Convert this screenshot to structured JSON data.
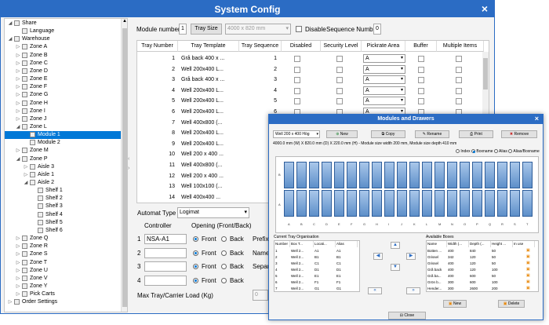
{
  "window": {
    "title": "System Config",
    "close": "×"
  },
  "tree": {
    "items": [
      {
        "label": "Share",
        "level": 0,
        "arrow": "◢",
        "icon": "share-icon"
      },
      {
        "label": "Language",
        "level": 1,
        "arrow": "",
        "icon": "globe-icon"
      },
      {
        "label": "Warehouse",
        "level": 0,
        "arrow": "◢",
        "icon": "warehouse-icon"
      },
      {
        "label": "Zone A",
        "level": 1,
        "arrow": "▷",
        "icon": "zone-icon"
      },
      {
        "label": "Zone B",
        "level": 1,
        "arrow": "▷",
        "icon": "zone-icon"
      },
      {
        "label": "Zone C",
        "level": 1,
        "arrow": "▷",
        "icon": "zone-icon"
      },
      {
        "label": "Zone D",
        "level": 1,
        "arrow": "▷",
        "icon": "zone-icon"
      },
      {
        "label": "Zone E",
        "level": 1,
        "arrow": "▷",
        "icon": "zone-icon"
      },
      {
        "label": "Zone F",
        "level": 1,
        "arrow": "▷",
        "icon": "zone-icon"
      },
      {
        "label": "Zone G",
        "level": 1,
        "arrow": "▷",
        "icon": "zone-icon"
      },
      {
        "label": "Zone H",
        "level": 1,
        "arrow": "▷",
        "icon": "zone-icon"
      },
      {
        "label": "Zone I",
        "level": 1,
        "arrow": "▷",
        "icon": "zone-icon"
      },
      {
        "label": "Zone J",
        "level": 1,
        "arrow": "▷",
        "icon": "zone-icon"
      },
      {
        "label": "Zone L",
        "level": 1,
        "arrow": "◢",
        "icon": "zone-icon"
      },
      {
        "label": "Module 1",
        "level": 2,
        "arrow": "",
        "icon": "module-icon",
        "selected": true
      },
      {
        "label": "Module 2",
        "level": 2,
        "arrow": "",
        "icon": "module-icon"
      },
      {
        "label": "Zone M",
        "level": 1,
        "arrow": "▷",
        "icon": "zone-icon"
      },
      {
        "label": "Zone P",
        "level": 1,
        "arrow": "◢",
        "icon": "zone-icon"
      },
      {
        "label": "Aisle 3",
        "level": 2,
        "arrow": "▷",
        "icon": "aisle-icon"
      },
      {
        "label": "Aisle 1",
        "level": 2,
        "arrow": "▷",
        "icon": "aisle-icon"
      },
      {
        "label": "Aisle 2",
        "level": 2,
        "arrow": "◢",
        "icon": "aisle-icon"
      },
      {
        "label": "Shelf 1",
        "level": 3,
        "arrow": "",
        "icon": "shelf-icon"
      },
      {
        "label": "Shelf 2",
        "level": 3,
        "arrow": "",
        "icon": "shelf-icon"
      },
      {
        "label": "Shelf 3",
        "level": 3,
        "arrow": "",
        "icon": "shelf-icon"
      },
      {
        "label": "Shelf 4",
        "level": 3,
        "arrow": "",
        "icon": "shelf-icon"
      },
      {
        "label": "Shelf 5",
        "level": 3,
        "arrow": "",
        "icon": "shelf-icon"
      },
      {
        "label": "Shelf 6",
        "level": 3,
        "arrow": "",
        "icon": "shelf-icon"
      },
      {
        "label": "Zone Q",
        "level": 1,
        "arrow": "▷",
        "icon": "zone-icon"
      },
      {
        "label": "Zone R",
        "level": 1,
        "arrow": "▷",
        "icon": "zone-icon"
      },
      {
        "label": "Zone S",
        "level": 1,
        "arrow": "▷",
        "icon": "zone-icon"
      },
      {
        "label": "Zone T",
        "level": 1,
        "arrow": "▷",
        "icon": "zone-icon"
      },
      {
        "label": "Zone U",
        "level": 1,
        "arrow": "▷",
        "icon": "zone-icon"
      },
      {
        "label": "Zone V",
        "level": 1,
        "arrow": "▷",
        "icon": "zone-icon"
      },
      {
        "label": "Zone Y",
        "level": 1,
        "arrow": "▷",
        "icon": "zone-icon"
      },
      {
        "label": "Pick Carts",
        "level": 1,
        "arrow": "▷",
        "icon": "cart-icon"
      },
      {
        "label": "Order Settings",
        "level": 0,
        "arrow": "▷",
        "icon": "settings-icon"
      }
    ]
  },
  "toolbar": {
    "module_number_label": "Module number",
    "module_number_value": "1",
    "tray_size_button": "Tray Size",
    "tray_size_value": "4000 x 820 mm",
    "disable_label": "Disable",
    "sequence_number_label": "Sequence Number",
    "sequence_number_value": "0"
  },
  "grid": {
    "columns": [
      "Tray Number",
      "Tray Template",
      "Tray Sequence",
      "Disabled",
      "Security Level",
      "Pickrate Area",
      "Buffer",
      "Multiple Items"
    ],
    "rows": [
      {
        "n": "1",
        "t": "Grå back 400 x ...",
        "s": "1",
        "p": "A"
      },
      {
        "n": "2",
        "t": "Well 200x400 L...",
        "s": "2",
        "p": "A"
      },
      {
        "n": "3",
        "t": "Grå back 400 x ...",
        "s": "3",
        "p": "A"
      },
      {
        "n": "4",
        "t": "Well 200x400 L...",
        "s": "4",
        "p": "A"
      },
      {
        "n": "5",
        "t": "Well 200x400 L...",
        "s": "5",
        "p": "A"
      },
      {
        "n": "6",
        "t": "Well 200x400 L...",
        "s": "6",
        "p": "A"
      },
      {
        "n": "7",
        "t": "Well 400x800 (...",
        "s": "",
        "p": ""
      },
      {
        "n": "8",
        "t": "Well 200x400 L...",
        "s": "",
        "p": ""
      },
      {
        "n": "9",
        "t": "Well 200x400 L...",
        "s": "",
        "p": ""
      },
      {
        "n": "10",
        "t": "Well 200 x 400 ...",
        "s": "",
        "p": ""
      },
      {
        "n": "11",
        "t": "Well 400x800 (...",
        "s": "",
        "p": ""
      },
      {
        "n": "12",
        "t": "Well 200 x 400 ...",
        "s": "",
        "p": ""
      },
      {
        "n": "13",
        "t": "Well 100x100 (...",
        "s": "",
        "p": ""
      },
      {
        "n": "14",
        "t": "Well 400x400 ...",
        "s": "",
        "p": ""
      }
    ]
  },
  "automat": {
    "type_label": "Automat Type",
    "type_value": "Logimat",
    "controller_label": "Controller",
    "opening_label": "Opening (Front/Back)",
    "controllers": [
      {
        "num": "1",
        "value": "NSA-A1"
      },
      {
        "num": "2",
        "value": ""
      },
      {
        "num": "3",
        "value": ""
      },
      {
        "num": "4",
        "value": ""
      }
    ],
    "front_label": "Front",
    "back_label": "Back",
    "prefix_label": "Prefix",
    "name_label": "Name",
    "separator_label": "Separa",
    "max_load_label": "Max Tray/Carrier Load (Kg)",
    "max_load_value": "0"
  },
  "dialog": {
    "title": "Modules and Drawers",
    "close": "×",
    "template_select": "Well 200 x 400 Hög",
    "new_button": "New",
    "copy_button": "Copy",
    "rename_button": "Rename",
    "print_button": "Print",
    "remove_button": "Remove",
    "info": "4000.0 mm (W) X 820.0 mm (D) X 220.0 mm (H) - Module size width 200 mm, Module size depth 410 mm",
    "view_index": "Index",
    "view_boxname": "Boxname",
    "view_alias": "Alias",
    "view_alias_boxname": "Alias/Boxname",
    "row_labels": [
      "B",
      "A"
    ],
    "column_labels": [
      "A",
      "B",
      "C",
      "D",
      "E",
      "F",
      "G",
      "H",
      "I",
      "J",
      "K",
      "L",
      "M",
      "N",
      "O",
      "P",
      "Q",
      "R",
      "S",
      "T"
    ],
    "current_label": "Current Tray Organisation",
    "current_columns": [
      "Number",
      "Box T...",
      "Locati...",
      "Alias"
    ],
    "current_rows": [
      [
        "1",
        "Well 2...",
        "A1",
        "A1"
      ],
      [
        "2",
        "Well 2...",
        "B1",
        "B1"
      ],
      [
        "3",
        "Well 2...",
        "C1",
        "C1"
      ],
      [
        "4",
        "Well 2...",
        "D1",
        "D1"
      ],
      [
        "5",
        "Well 2...",
        "E1",
        "E1"
      ],
      [
        "6",
        "Well 2...",
        "F1",
        "F1"
      ],
      [
        "7",
        "Well 2...",
        "G1",
        "G1"
      ]
    ],
    "available_label": "Available Boxes",
    "available_columns": [
      "Name",
      "Width (...",
      "Depth (...",
      "Height ...",
      "In use"
    ],
    "available_rows": [
      [
        "Botten ...",
        "400",
        "840",
        "50"
      ],
      [
        "Grissel",
        "342",
        "120",
        "50"
      ],
      [
        "Grissel",
        "400",
        "120",
        "50"
      ],
      [
        "Grå back",
        "400",
        "120",
        "100"
      ],
      [
        "Grå ba...",
        "400",
        "600",
        "50"
      ],
      [
        "Grön b...",
        "300",
        "600",
        "100"
      ],
      [
        "Hender...",
        "300",
        "2600",
        "200"
      ]
    ],
    "avail_new_button": "New",
    "avail_delete_button": "Delete",
    "close_button": "Close"
  }
}
